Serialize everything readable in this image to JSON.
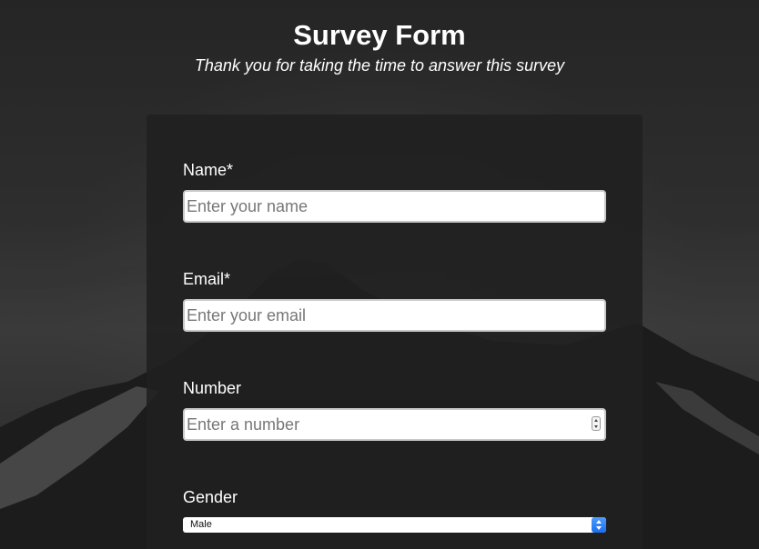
{
  "header": {
    "title": "Survey Form",
    "description": "Thank you for taking the time to answer this survey"
  },
  "form": {
    "name": {
      "label": "Name*",
      "placeholder": "Enter your name",
      "value": ""
    },
    "email": {
      "label": "Email*",
      "placeholder": "Enter your email",
      "value": ""
    },
    "number": {
      "label": "Number",
      "placeholder": "Enter a number",
      "value": ""
    },
    "gender": {
      "label": "Gender",
      "selected": "Male"
    }
  },
  "icons": {
    "number_spinner": "stepper-icon",
    "select_arrow": "chevron-updown-icon"
  },
  "colors": {
    "background": "#2a2a2a",
    "card": "#202020",
    "text": "#ffffff",
    "select_accent": "#1b6ef0"
  }
}
